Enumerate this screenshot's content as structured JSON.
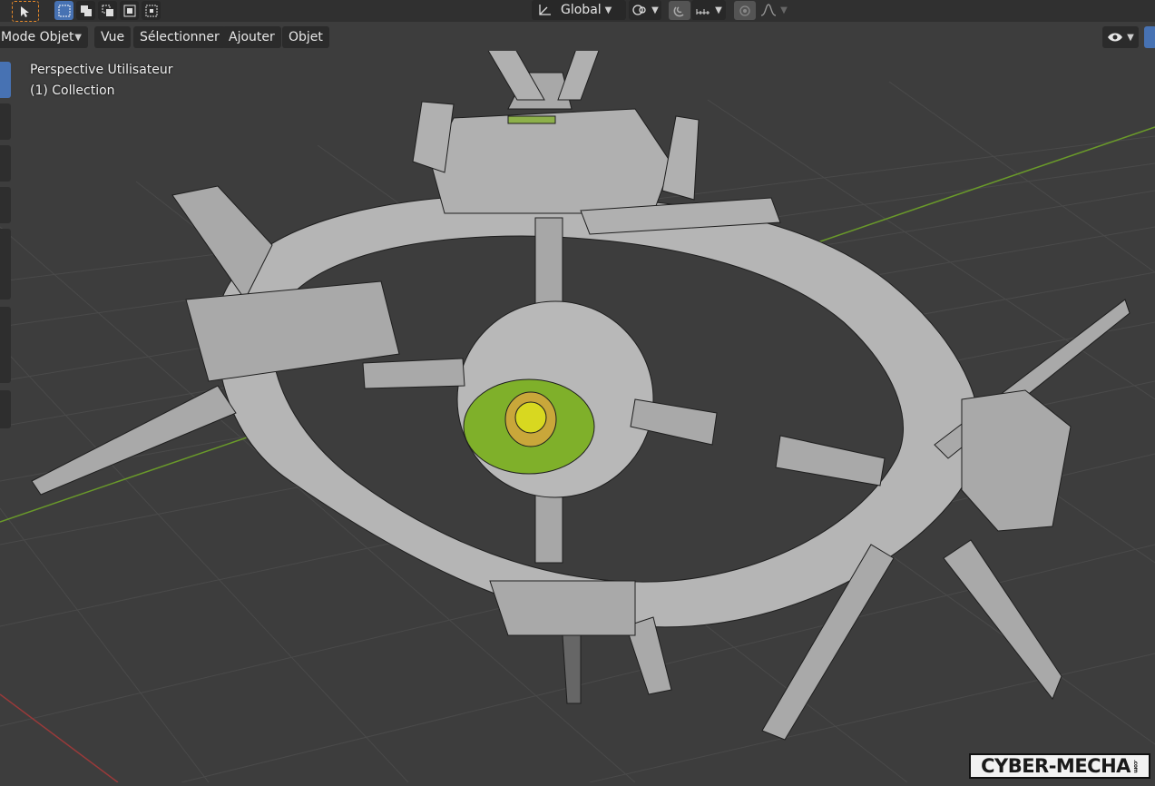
{
  "toolbar": {
    "transform_orientation": "Global",
    "select_tool_icon": "cursor-arrow-icon",
    "select_modes": [
      "select-new-icon",
      "select-extend-icon",
      "select-subtract-icon",
      "select-invert-icon",
      "select-intersect-icon"
    ],
    "pivot_icon": "transform-pivot-icon",
    "snap_icon": "magnet-snap-icon",
    "snap_target_icon": "snap-increment-icon",
    "proportional_icon": "proportional-editing-icon",
    "falloff_icon": "falloff-curve-icon"
  },
  "header": {
    "mode": "Mode Objet",
    "menus": [
      "Vue",
      "Sélectionner",
      "Ajouter",
      "Objet"
    ],
    "visibility_icon": "eye-visibility-icon"
  },
  "viewport": {
    "view_name": "Perspective Utilisateur",
    "collection": "(1) Collection",
    "colors": {
      "background": "#3d3d3d",
      "grid": "#4a4a4a",
      "x_axis": "#9a3a3a",
      "y_axis": "#6a9a2a",
      "mesh": "#b8b8b8",
      "wire": "#1e1e1e",
      "eye": "#7fb02a",
      "pupil": "#d8d820"
    }
  },
  "watermark": {
    "text": "CYBER-MECHA",
    "suffix": ".com"
  }
}
